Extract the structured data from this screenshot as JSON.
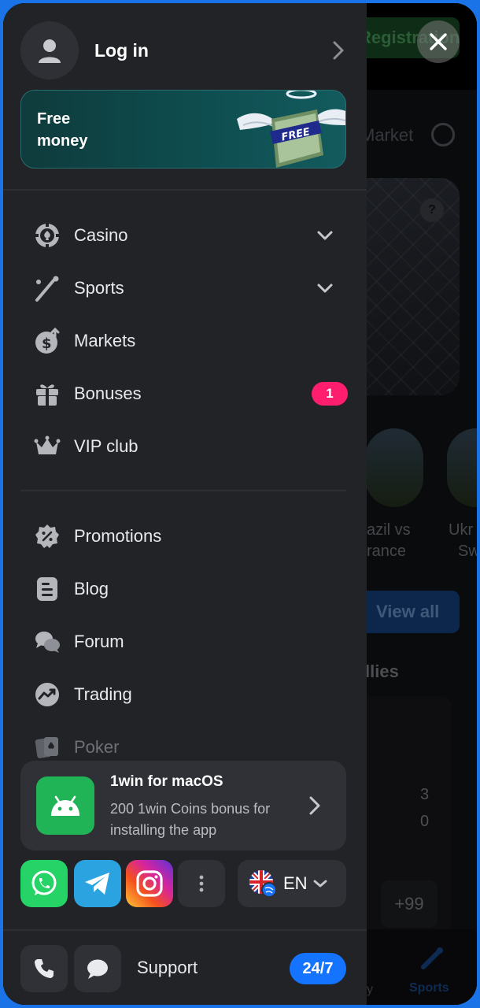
{
  "background_page": {
    "registration_label": "Registration",
    "market_label": "Market",
    "match_1_text": [
      "azil vs",
      "rance"
    ],
    "match_2_text": [
      "Ukr",
      "Sw"
    ],
    "view_all_label": "View all",
    "allies_heading": "llies",
    "score_1": "3",
    "score_2": "0",
    "more_odds_label": "+99",
    "nav_sports_label": "Sports",
    "nav_partial_label": "y"
  },
  "drawer": {
    "login_label": "Log in",
    "promo_banner": {
      "line1": "Free",
      "line2": "money",
      "art_badge": "FREE"
    },
    "menu_primary": [
      {
        "label": "Casino",
        "icon": "casino-chip-icon"
      },
      {
        "label": "Sports",
        "icon": "sports-stick-icon"
      },
      {
        "label": "Markets",
        "icon": "markets-dollar-icon"
      },
      {
        "label": "Bonuses",
        "icon": "gift-icon",
        "badge": "1"
      },
      {
        "label": "VIP club",
        "icon": "crown-icon"
      }
    ],
    "menu_secondary": [
      {
        "label": "Promotions",
        "icon": "percent-badge-icon"
      },
      {
        "label": "Blog",
        "icon": "document-icon"
      },
      {
        "label": "Forum",
        "icon": "chat-bubbles-icon"
      },
      {
        "label": "Trading",
        "icon": "trend-chart-icon"
      },
      {
        "label": "Poker",
        "icon": "playing-cards-icon"
      }
    ],
    "app_promo": {
      "title": "1win for macOS",
      "subtitle": "200 1win Coins bonus for installing the app"
    },
    "social": [
      "whatsapp-icon",
      "telegram-icon",
      "instagram-icon",
      "more-vertical-icon"
    ],
    "language": {
      "code": "EN",
      "flag": "uk-flag-icon"
    },
    "support": {
      "label": "Support",
      "badge": "24/7"
    }
  },
  "colors": {
    "drawer_bg": "#222326",
    "accent_blue": "#1473ff",
    "badge_pink": "#ff1e6d",
    "android_green": "#21b457",
    "frame_blue": "#1b73e8"
  }
}
